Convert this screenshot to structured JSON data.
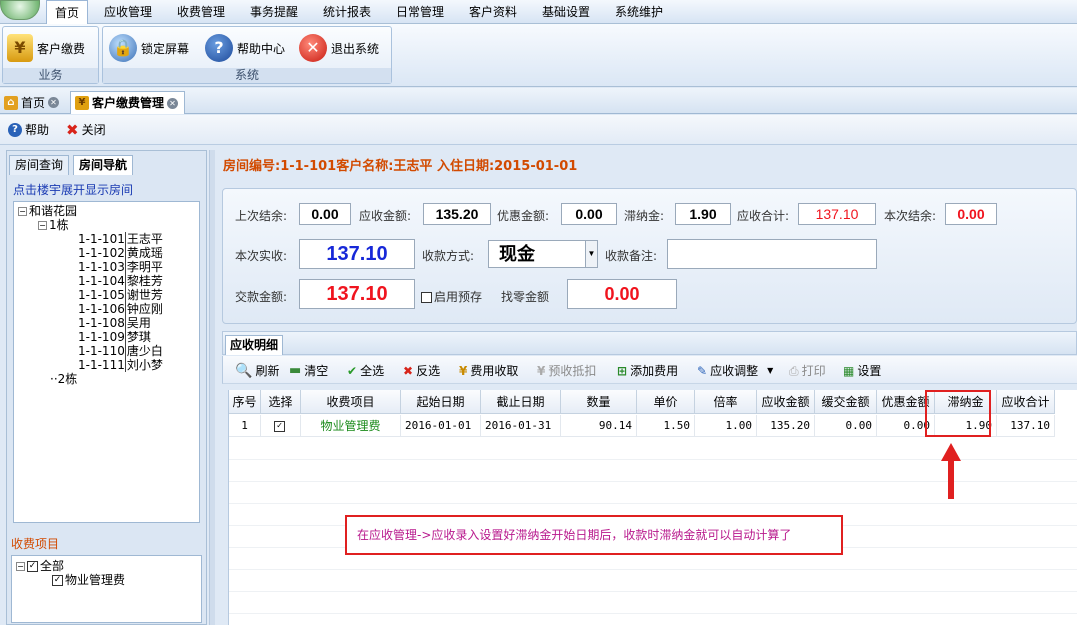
{
  "menu": [
    "首页",
    "收费管理",
    "收费管理",
    "事务提醒",
    "统计报表",
    "日常管理",
    "客户资料",
    "基础设置",
    "系统维护"
  ],
  "menu_real": [
    "首页",
    "应收管理",
    "收费管理",
    "事务提醒",
    "统计报表",
    "日常管理",
    "客户资料",
    "基础设置",
    "系统维护"
  ],
  "ribbon": {
    "group_business": "业务",
    "group_system": "系统",
    "btn_pay": "客户缴费",
    "btn_lock": "锁定屏幕",
    "btn_help": "帮助中心",
    "btn_exit": "退出系统"
  },
  "tabs": {
    "home": "首页",
    "pay": "客户缴费管理"
  },
  "toolbar": {
    "help": "帮助",
    "close": "关闭"
  },
  "left": {
    "tab_query": "房间查询",
    "tab_nav": "房间导航",
    "hint": "点击楼宇展开显示房间",
    "tree_root": "和谐花园",
    "building1": "1栋",
    "building2": "2栋",
    "rooms": [
      {
        "no": "1-1-101",
        "name": "王志平"
      },
      {
        "no": "1-1-102",
        "name": "黄成瑶"
      },
      {
        "no": "1-1-103",
        "name": "李明平"
      },
      {
        "no": "1-1-104",
        "name": "黎桂芳"
      },
      {
        "no": "1-1-105",
        "name": "谢世芳"
      },
      {
        "no": "1-1-106",
        "name": "钟应刚"
      },
      {
        "no": "1-1-108",
        "name": "吴用"
      },
      {
        "no": "1-1-109",
        "name": "梦琪"
      },
      {
        "no": "1-1-110",
        "name": "唐少白"
      },
      {
        "no": "1-1-111",
        "name": "刘小梦"
      }
    ],
    "fee_title": "收费项目",
    "fee_all": "全部",
    "fee_item": "物业管理费"
  },
  "room_header": "房间编号:1-1-101客户名称:王志平 入住日期:2015-01-01",
  "form": {
    "last_balance_label": "上次结余:",
    "last_balance": "0.00",
    "receivable_label": "应收金额:",
    "receivable": "135.20",
    "discount_label": "优惠金额:",
    "discount": "0.00",
    "late_fee_label": "滞纳金:",
    "late_fee": "1.90",
    "total_label": "应收合计:",
    "total": "137.10",
    "this_balance_label": "本次结余:",
    "this_balance": "0.00",
    "actual_label": "本次实收:",
    "actual": "137.10",
    "method_label": "收款方式:",
    "method": "现金",
    "remark_label": "收款备注:",
    "paid_label": "交款金额:",
    "paid": "137.10",
    "prepay_label": "启用预存",
    "change_label": "找零金额",
    "change": "0.00"
  },
  "detail": {
    "tab": "应收明细",
    "tools": [
      "刷新",
      "清空",
      "全选",
      "反选",
      "费用收取",
      "预收抵扣",
      "添加费用",
      "应收调整",
      "打印",
      "设置"
    ],
    "columns": [
      "序号",
      "选择",
      "收费项目",
      "起始日期",
      "截止日期",
      "数量",
      "单价",
      "倍率",
      "应收金额",
      "缓交金额",
      "优惠金额",
      "滞纳金",
      "应收合计"
    ],
    "rows": [
      [
        "1",
        "✓",
        "物业管理费",
        "2016-01-01",
        "2016-01-31",
        "90.14",
        "1.50",
        "1.00",
        "135.20",
        "0.00",
        "0.00",
        "1.90",
        "137.10"
      ]
    ]
  },
  "note": "在应收管理->应收录入设置好滞纳金开始日期后，收款时滞纳金就可以自动计算了",
  "colors": {
    "accent_orange": "#d24a00",
    "red": "#f0141e",
    "blue": "#1728d8",
    "highlight": "#e02020",
    "note_text": "#b8198d"
  }
}
